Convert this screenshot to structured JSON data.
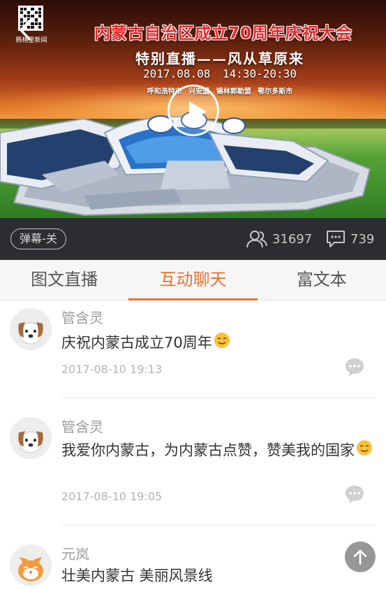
{
  "banner": {
    "logo_text": "腾格里新闻",
    "title": "内蒙古自治区成立70周年庆祝大会",
    "subtitle": "特别直播——风从草原来",
    "datetime": "2017.08.08    14:30-20:30",
    "cities": "呼和浩特市  兴安盟  锡林郭勒盟  鄂尔多斯市"
  },
  "statbar": {
    "danmu_label": "弹幕-关",
    "viewers": "31697",
    "comments": "739"
  },
  "tabs": [
    {
      "label": "图文直播",
      "active": false
    },
    {
      "label": "互动聊天",
      "active": true
    },
    {
      "label": "富文本",
      "active": false
    }
  ],
  "colors": {
    "accent": "#f2702b",
    "title_red": "#e8262a",
    "statbar_bg": "#2b2d31"
  },
  "comments": [
    {
      "name": "管含灵",
      "text": "庆祝内蒙古成立70周年",
      "emoji": "smile-emoji",
      "time": "2017-08-10 19:13",
      "avatar": "dog-avatar"
    },
    {
      "name": "管含灵",
      "text": "我爱你内蒙古，为内蒙古点赞，赞美我的国家",
      "emoji": "smile-emoji",
      "time": "2017-08-10 19:05",
      "avatar": "dog-avatar"
    },
    {
      "name": "元岚",
      "text": "壮美内蒙古 美丽风景线",
      "emoji": "",
      "time": "",
      "avatar": "cat-avatar"
    }
  ]
}
